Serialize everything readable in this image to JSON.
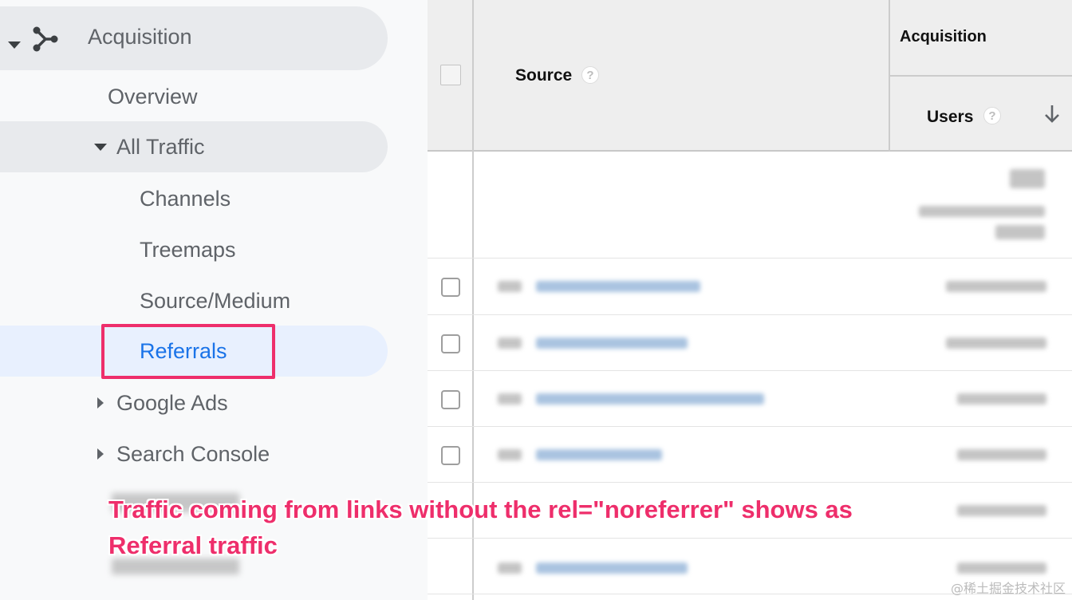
{
  "sidebar": {
    "acquisition": "Acquisition",
    "items": {
      "overview": "Overview",
      "all_traffic": "All Traffic",
      "channels": "Channels",
      "treemaps": "Treemaps",
      "source_medium": "Source/Medium",
      "referrals": "Referrals",
      "google_ads": "Google Ads",
      "search_console": "Search Console"
    },
    "highlight_color": "#ee2e6b",
    "active_color": "#1a73e8"
  },
  "table": {
    "source_header": "Source",
    "group_header": "Acquisition",
    "users_header": "Users",
    "help_glyph": "?",
    "sort_icon": "arrow-down-icon",
    "rows": 6
  },
  "annotation": {
    "line1": "Traffic coming from links without the rel=\"noreferrer\" shows as",
    "line2": "Referral traffic"
  },
  "watermark": "@稀土掘金技术社区"
}
